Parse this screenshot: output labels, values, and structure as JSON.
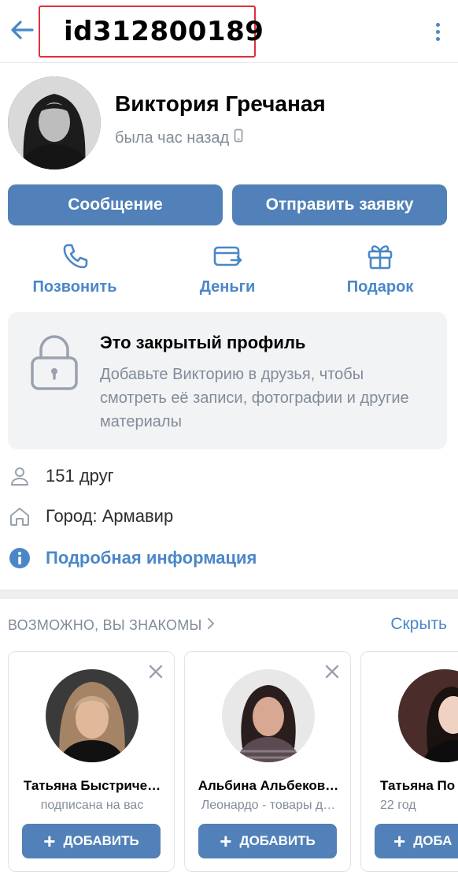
{
  "header": {
    "back_icon": "arrow-left-icon",
    "profile_id": "id312800189",
    "menu_icon": "more-vertical-icon",
    "accent_color": "#4b87c8",
    "highlight_box_color": "#e0303a"
  },
  "profile": {
    "name": "Виктория Гречаная",
    "last_seen": "была час назад",
    "device_icon": "phone-icon"
  },
  "buttons": {
    "message": "Сообщение",
    "add_friend_request": "Отправить заявку",
    "button_color": "#5181b8"
  },
  "actions": [
    {
      "icon": "phone-icon",
      "label": "Позвонить"
    },
    {
      "icon": "money-transfer-icon",
      "label": "Деньги"
    },
    {
      "icon": "gift-icon",
      "label": "Подарок"
    }
  ],
  "closed_profile": {
    "icon": "lock-icon",
    "title": "Это закрытый профиль",
    "description": "Добавьте Викторию в друзья, чтобы смотреть её записи, фотографии и другие материалы"
  },
  "info": {
    "friends": "151 друг",
    "city": "Город: Армавир",
    "details_link": "Подробная информация"
  },
  "suggestions": {
    "title": "ВОЗМОЖНО, ВЫ ЗНАКОМЫ",
    "hide": "Скрыть",
    "cards": [
      {
        "name": "Татьяна Быстриче…",
        "subtitle": "подписана на вас",
        "button": "ДОБАВИТЬ"
      },
      {
        "name": "Альбина Альбеков…",
        "subtitle": "Леонардо - товары д…",
        "button": "ДОБАВИТЬ"
      },
      {
        "name": "Татьяна По",
        "subtitle": "22 год",
        "button": "ДОБА"
      }
    ]
  }
}
